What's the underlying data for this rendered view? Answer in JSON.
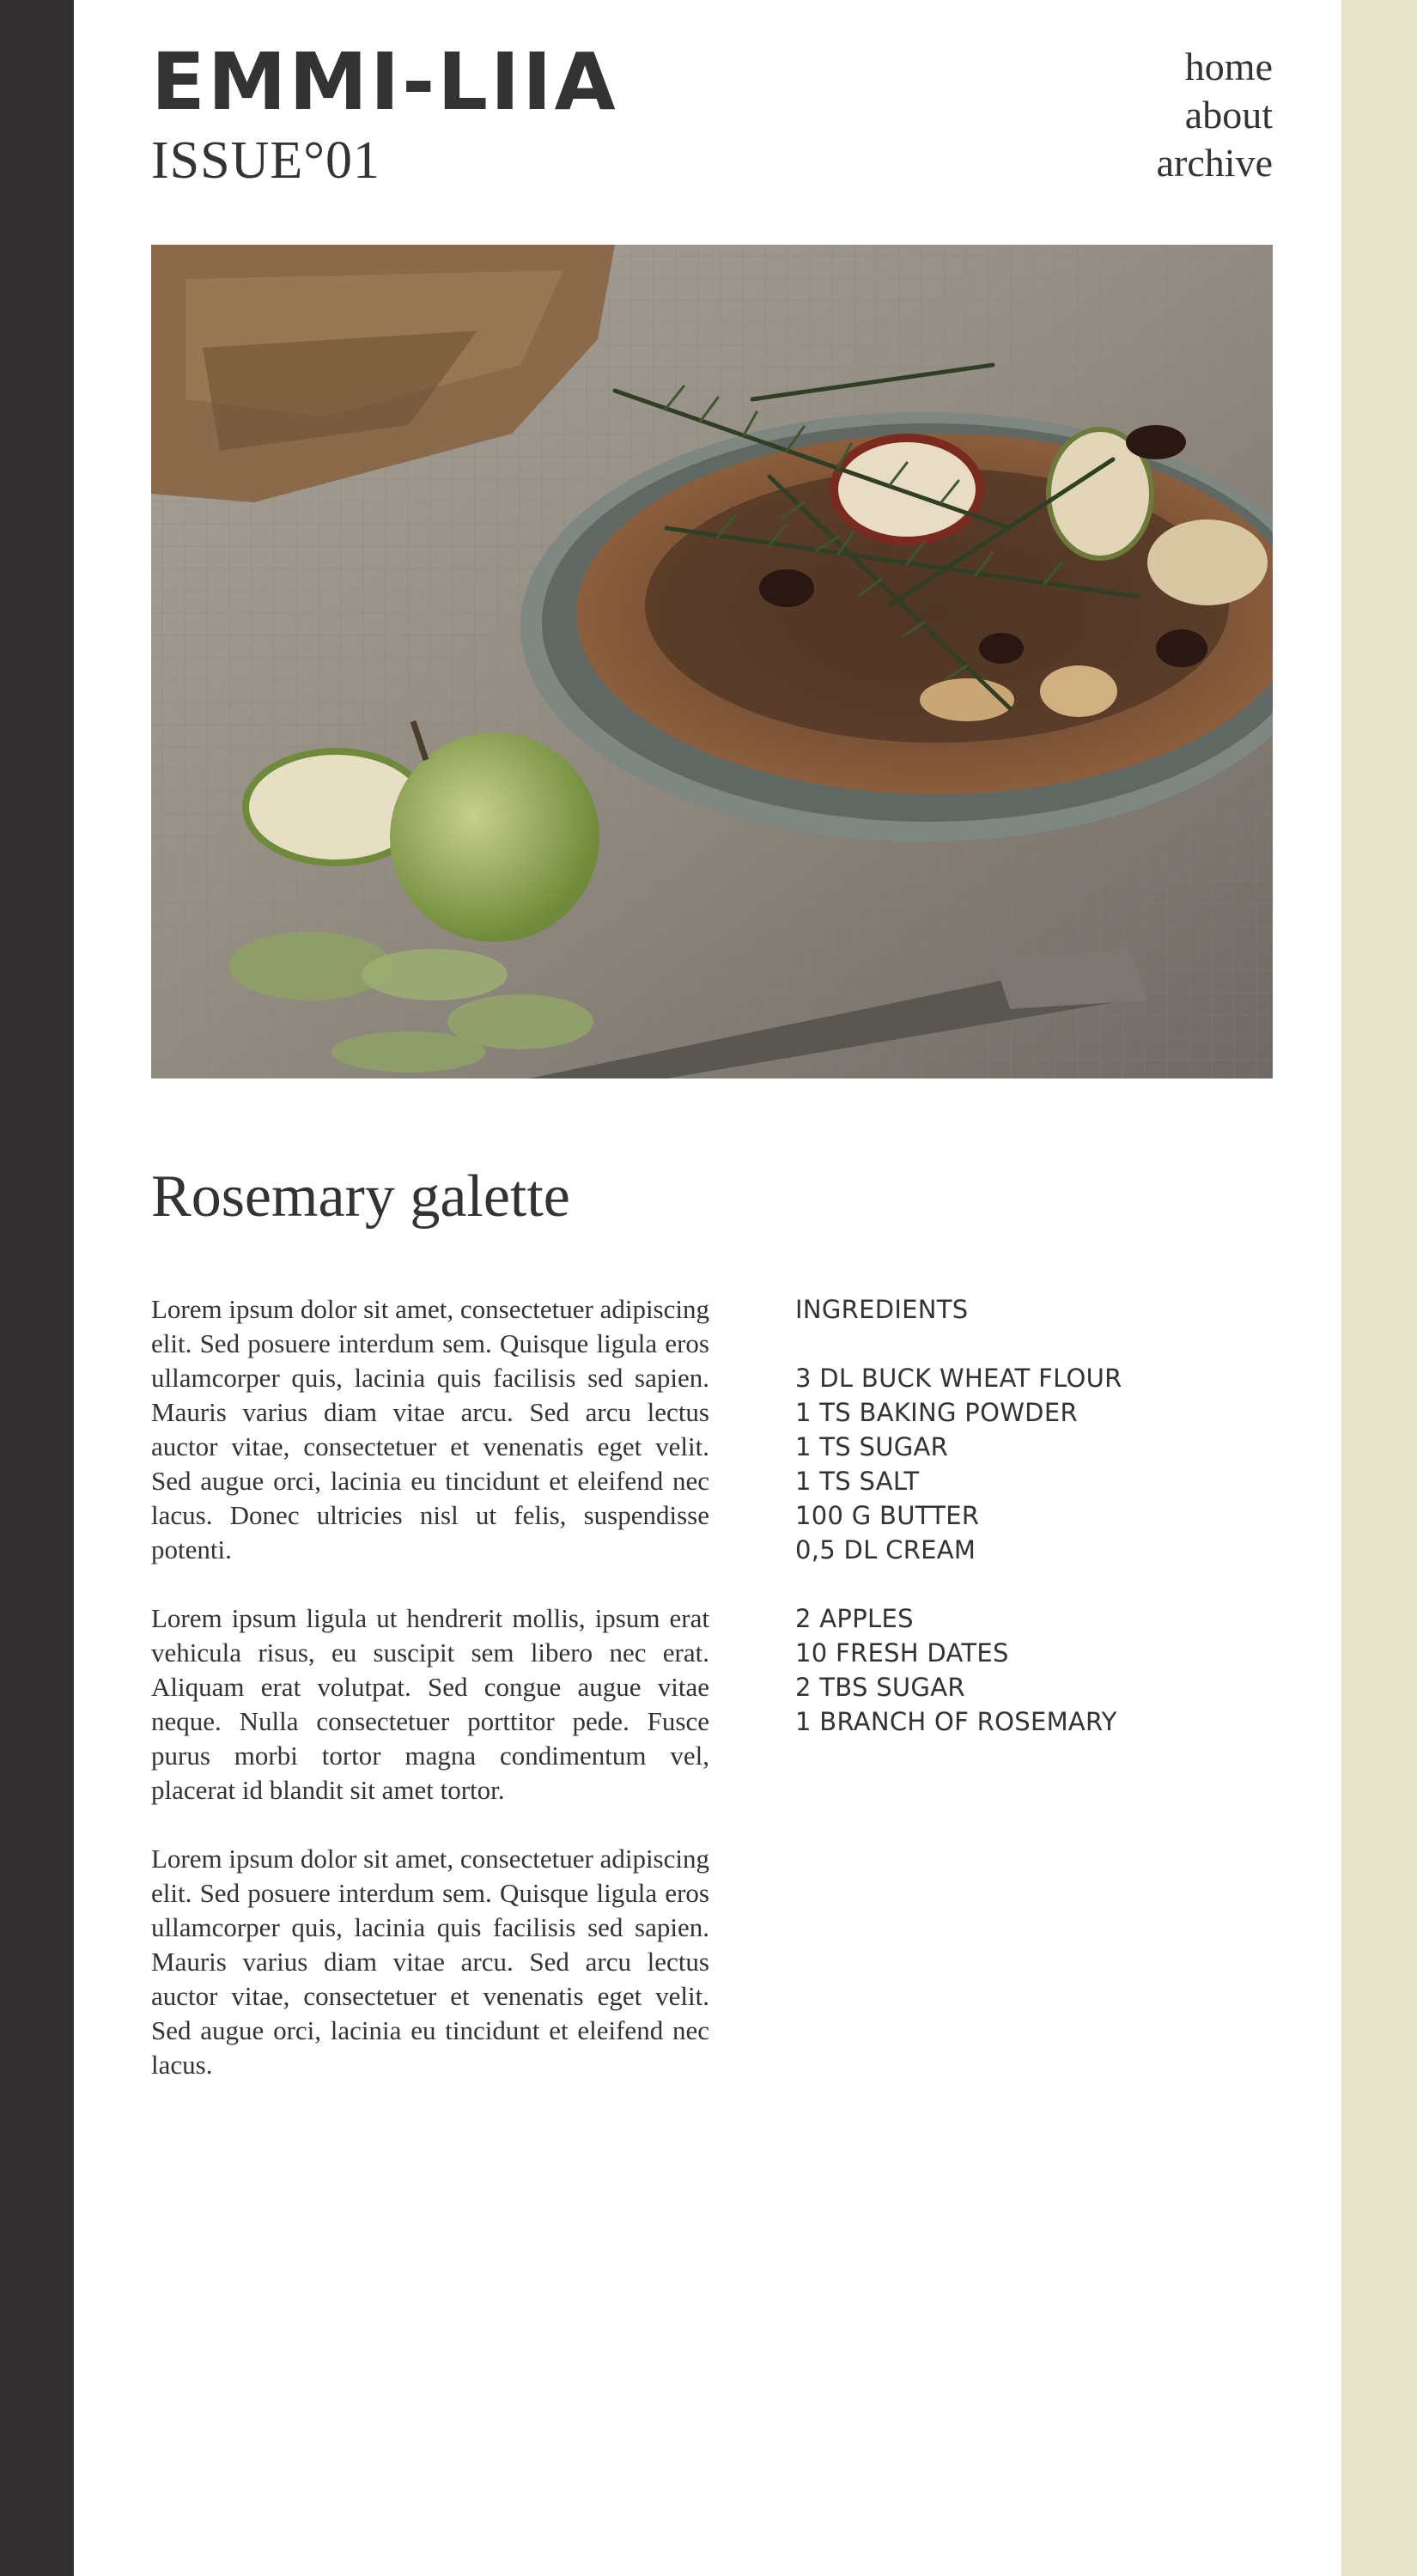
{
  "site": {
    "brand": "EMMI-LIIA",
    "issue": "ISSUE°01"
  },
  "nav": {
    "items": [
      {
        "label": "home"
      },
      {
        "label": "about"
      },
      {
        "label": "archive"
      }
    ]
  },
  "article": {
    "title": "Rosemary galette",
    "paragraphs": [
      "Lorem ipsum dolor sit amet, consectetuer adipiscing elit. Sed posuere interdum sem. Quisque ligula eros ullamcorper quis, lacinia quis facilisis sed sapien. Mauris varius diam vitae arcu. Sed arcu lectus auctor vitae, consectetuer et venenatis eget velit. Sed augue orci, lacinia eu tincidunt et eleifend nec lacus. Donec ultricies nisl ut felis, suspendisse potenti.",
      "Lorem ipsum ligula ut hendrerit mollis, ipsum erat vehicula risus, eu suscipit sem libero nec erat. Aliquam erat volutpat. Sed congue augue vitae neque. Nulla consectetuer porttitor pede. Fusce purus morbi tortor magna condimentum vel, placerat id blandit sit amet tortor.",
      "Lorem ipsum dolor sit amet, consectetuer adipiscing elit. Sed posuere interdum sem. Quisque ligula eros ullamcorper quis, lacinia quis facilisis sed sapien. Mauris varius diam vitae arcu. Sed arcu lectus auctor vitae, consectetuer et venenatis eget velit. Sed augue orci, lacinia eu tincidunt et eleifend nec lacus."
    ]
  },
  "ingredients": {
    "heading": "INGREDIENTS",
    "groups": [
      [
        "3 DL BUCK WHEAT FLOUR",
        "1 TS BAKING POWDER",
        "1 TS SUGAR",
        "1 TS SALT",
        "100 G BUTTER",
        "0,5 DL CREAM"
      ],
      [
        "2 APPLES",
        "10 FRESH DATES",
        "2 TBS SUGAR",
        "1 BRANCH OF ROSEMARY"
      ]
    ]
  },
  "colors": {
    "left_bar": "#323031",
    "right_bar": "#e8e4c9",
    "text": "#333333",
    "page": "#ffffff"
  }
}
